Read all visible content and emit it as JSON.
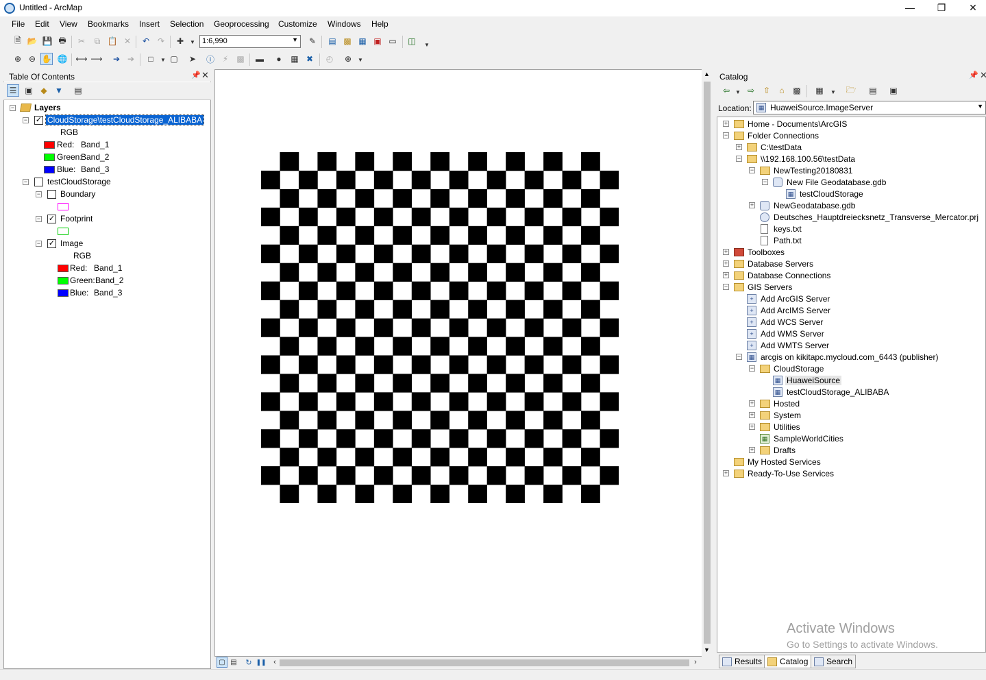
{
  "window": {
    "title": "Untitled - ArcMap"
  },
  "menu": [
    "File",
    "Edit",
    "View",
    "Bookmarks",
    "Insert",
    "Selection",
    "Geoprocessing",
    "Customize",
    "Windows",
    "Help"
  ],
  "toolbar": {
    "scale_value": "1:6,990"
  },
  "toc": {
    "title": "Table Of Contents",
    "layers_label": "Layers",
    "layer1": {
      "name": "CloudStorage\\testCloudStorage_ALIBABA",
      "rgb": "RGB",
      "bands": [
        {
          "label": "Red:",
          "band": "Band_1",
          "color": "#ff0000"
        },
        {
          "label": "Green:",
          "band": "Band_2",
          "color": "#00ff00"
        },
        {
          "label": "Blue:",
          "band": "Band_3",
          "color": "#0000ff"
        }
      ]
    },
    "layer2": {
      "name": "testCloudStorage",
      "boundary": "Boundary",
      "boundary_color": "#ff00ff",
      "footprint": "Footprint",
      "footprint_color": "#00cc00",
      "image": "Image",
      "rgb": "RGB",
      "bands": [
        {
          "label": "Red:",
          "band": "Band_1",
          "color": "#ff0000"
        },
        {
          "label": "Green:",
          "band": "Band_2",
          "color": "#00ff00"
        },
        {
          "label": "Blue:",
          "band": "Band_3",
          "color": "#0000ff"
        }
      ]
    }
  },
  "map": {
    "checker_cols": 19,
    "checker_rows": 19
  },
  "catalog": {
    "title": "Catalog",
    "location_label": "Location:",
    "location_value": "HuaweiSource.ImageServer",
    "items": {
      "home": "Home - Documents\\ArcGIS",
      "folder_connections": "Folder Connections",
      "c_testdata": "C:\\testData",
      "unc_testdata": "\\\\192.168.100.56\\testData",
      "newtesting": "NewTesting20180831",
      "new_gdb": "New File Geodatabase.gdb",
      "test_cloud": "testCloudStorage",
      "newgeodb": "NewGeodatabase.gdb",
      "prj": "Deutsches_Hauptdreiecksnetz_Transverse_Mercator.prj",
      "keys": "keys.txt",
      "path": "Path.txt",
      "toolboxes": "Toolboxes",
      "db_servers": "Database Servers",
      "db_connections": "Database Connections",
      "gis_servers": "GIS Servers",
      "add_arcgis": "Add ArcGIS Server",
      "add_arcims": "Add ArcIMS Server",
      "add_wcs": "Add WCS Server",
      "add_wms": "Add WMS Server",
      "add_wmts": "Add WMTS Server",
      "arcgis_on": "arcgis on kikitapc.mycloud.com_6443 (publisher)",
      "cloudstorage": "CloudStorage",
      "huaweisource": "HuaweiSource",
      "test_alibaba": "testCloudStorage_ALIBABA",
      "hosted": "Hosted",
      "system": "System",
      "utilities": "Utilities",
      "sampleworld": "SampleWorldCities",
      "drafts": "Drafts",
      "my_hosted": "My Hosted Services",
      "ready_to_use": "Ready-To-Use Services"
    },
    "tabs": [
      "Results",
      "Catalog",
      "Search"
    ]
  },
  "watermark": {
    "line1": "Activate Windows",
    "line2": "Go to Settings to activate Windows."
  }
}
